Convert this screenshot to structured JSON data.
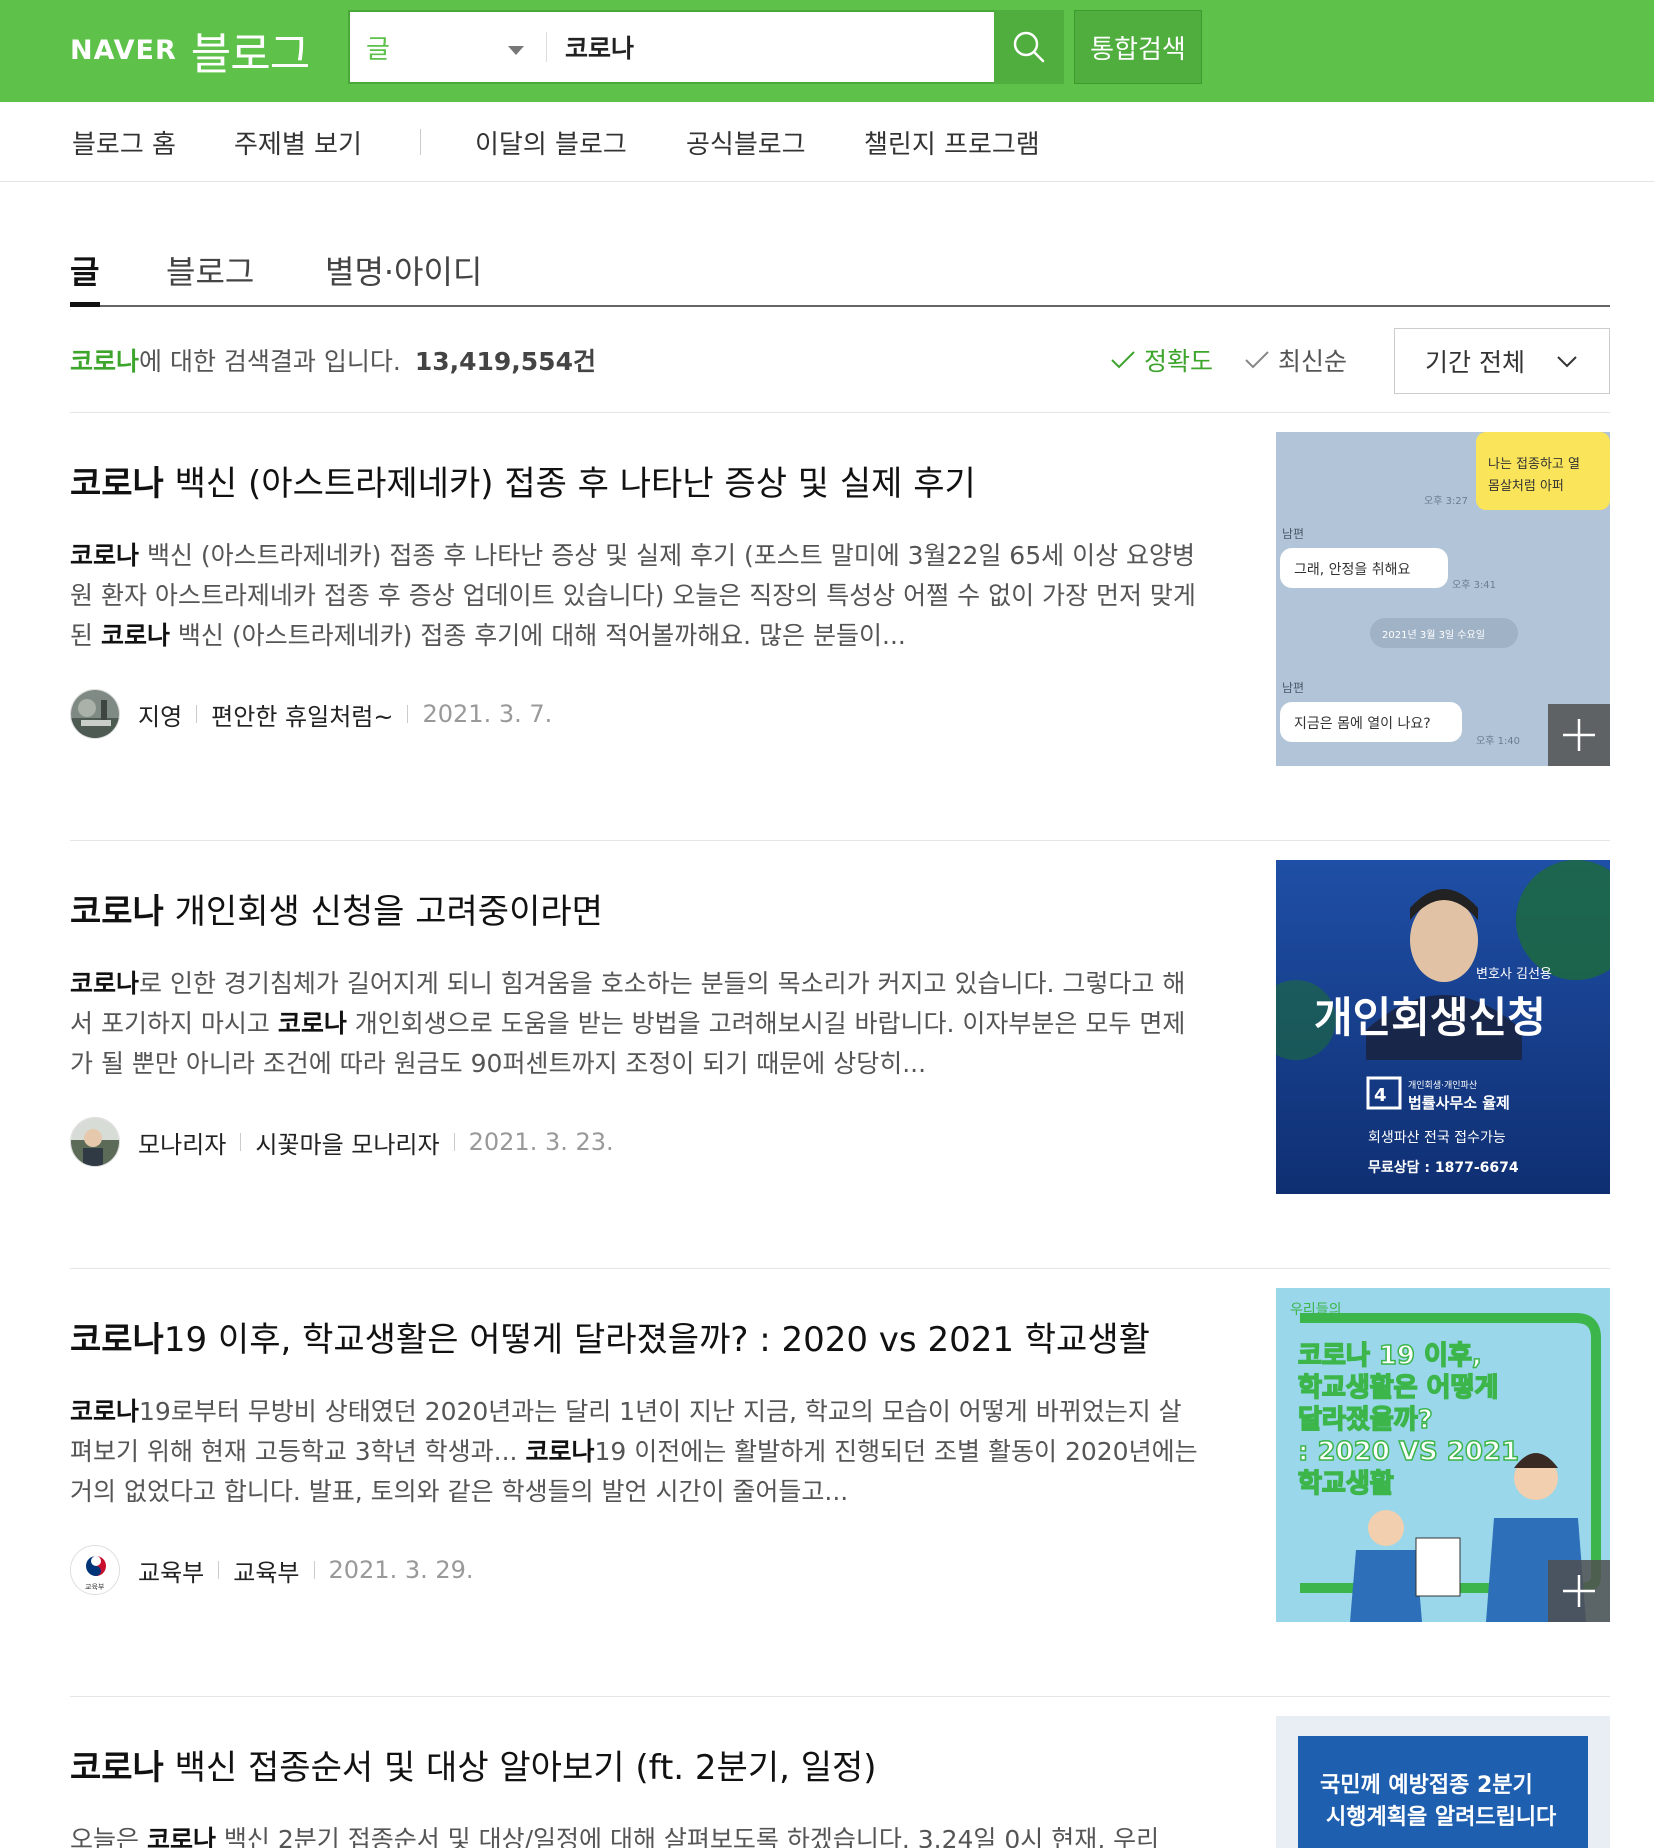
{
  "header": {
    "logo_naver": "NAVER",
    "logo_blog": "블로그",
    "search_type": "글",
    "search_value": "코로나",
    "total_search_label": "통합검색"
  },
  "nav": {
    "items": [
      {
        "label": "블로그 홈"
      },
      {
        "label": "주제별 보기"
      },
      {
        "label": "이달의 블로그"
      },
      {
        "label": "공식블로그"
      },
      {
        "label": "챌린지 프로그램"
      }
    ]
  },
  "tabs": [
    {
      "label": "글"
    },
    {
      "label": "블로그"
    },
    {
      "label": "별명·아이디"
    }
  ],
  "result_info": {
    "keyword": "코로나",
    "suffix": "에 대한 검색결과 입니다.",
    "count": "13,419,554건"
  },
  "sort": {
    "accuracy": "정확도",
    "latest": "최신순",
    "period": "기간 전체"
  },
  "results": [
    {
      "title_kw": "코로나",
      "title_rest": " 백신 (아스트라제네카) 접종 후 나타난 증상 및 실제 후기",
      "s1": "코로나",
      "s2": " 백신 (아스트라제네카) 접종 후 나타난 증상 및 실제 후기 (포스트 말미에 3월22일 65세 이상 요양병원 환자 아스트라제네카 접종 후 증상 업데이트 있습니다) 오늘은 직장의 특성상 어쩔 수 없이 가장 먼저 맞게 된 ",
      "s3": "코로나",
      "s4": " 백신 (아스트라제네카) 접종 후기에 대해 적어볼까해요. 많은 분들이...",
      "author": "지영",
      "blog": "편안한 휴일처럼~",
      "date": "2021. 3. 7.",
      "thumb_texts": {
        "bubble_top": "나는 접종하고 열 몸살처럼 아퍼",
        "time1": "오후 3:27",
        "sender1": "남편",
        "msg1": "그래, 안정을 취해요",
        "time2": "오후 3:41",
        "date_pill": "2021년 3월 3일 수요일",
        "sender2": "남편",
        "msg2": "지금은 몸에 열이 나요?",
        "time3": "오후 1:40"
      }
    },
    {
      "title_kw": "코로나",
      "title_rest": " 개인회생 신청을 고려중이라면",
      "s1": "코로나",
      "s2": "로 인한 경기침체가 길어지게 되니 힘겨움을 호소하는 분들의 목소리가 커지고 있습니다. 그렇다고 해서 포기하지 마시고 ",
      "s3": "코로나",
      "s4": " 개인회생으로 도움을 받는 방법을 고려해보시길 바랍니다. 이자부분은 모두 면제가 될 뿐만 아니라 조건에 따라 원금도 90퍼센트까지 조정이 되기 때문에 상당히...",
      "author": "모나리자",
      "blog": "시꽃마을 모나리자",
      "date": "2021. 3. 23.",
      "thumb_texts": {
        "lawyer": "변호사 김선용",
        "headline": "개인회생신청",
        "firm_small": "개인회생·개인파산",
        "firm": "법률사무소 율제",
        "line1": "회생파산 전국 접수가능",
        "line2": "무료상담 : 1877-6674"
      }
    },
    {
      "title_kw": "코로나",
      "title_rest": "19 이후, 학교생활은 어떻게 달라졌을까? : 2020 vs 2021 학교생활",
      "s1": "코로나",
      "s2": "19로부터 무방비 상태였던 2020년과는 달리 1년이 지난 지금, 학교의 모습이 어떻게 바뀌었는지 살펴보기 위해 현재 고등학교 3학년 학생과... ",
      "s3": "코로나",
      "s4": "19 이전에는 활발하게 진행되던 조별 활동이 2020년에는 거의 없었다고 합니다. 발표, 토의와 같은 학생들의 발언 시간이 줄어들고...",
      "author": "교육부",
      "blog": "교육부",
      "date": "2021. 3. 29.",
      "avatar_text": "교육부",
      "thumb_texts": {
        "brand": "우리들의",
        "line1": "코로나 19 이후,",
        "line2": "학교생활은 어떻게",
        "line3": "달라졌을까?",
        "line4": ": 2020 VS 2021",
        "line5": "학교생활"
      }
    },
    {
      "title_kw": "코로나",
      "title_rest": " 백신 접종순서 및 대상 알아보기 (ft. 2분기, 일정)",
      "s1": "오늘은 ",
      "s2": "코로나",
      "s3": " 백신 2분기 접종순서 및 대상/일정에 대해 살펴보도록 하겠습니다. 3.24일 0시 현재, 우리",
      "thumb_texts": {
        "line1": "국민께 예방접종 2분기",
        "line2": "시행계획을 알려드립니다"
      }
    }
  ],
  "colors": {
    "brand_green": "#5dc14a",
    "keyword_green": "#3da52c"
  },
  "icons": [
    "search-icon",
    "caret-down-icon",
    "check-icon",
    "chevron-down-icon",
    "plus-icon"
  ]
}
